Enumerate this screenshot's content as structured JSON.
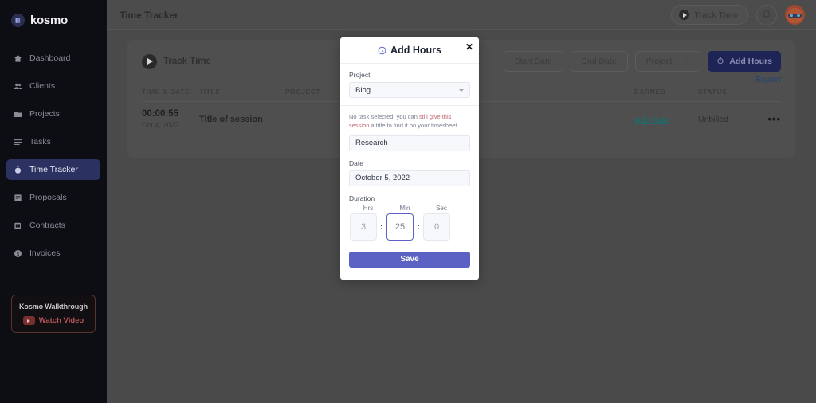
{
  "sidebar": {
    "brand": "kosmo",
    "brand_mark_icon": "kosmo-logo-icon",
    "items": [
      {
        "label": "Dashboard",
        "icon": "home-icon",
        "active": false
      },
      {
        "label": "Clients",
        "icon": "people-icon",
        "active": false
      },
      {
        "label": "Projects",
        "icon": "folder-icon",
        "active": false
      },
      {
        "label": "Tasks",
        "icon": "list-icon",
        "active": false
      },
      {
        "label": "Time Tracker",
        "icon": "stopwatch-icon",
        "active": true
      },
      {
        "label": "Proposals",
        "icon": "document-icon",
        "active": false
      },
      {
        "label": "Contracts",
        "icon": "contract-icon",
        "active": false
      },
      {
        "label": "Invoices",
        "icon": "dollar-circle-icon",
        "active": false
      }
    ],
    "walkthrough": {
      "title": "Kosmo Walkthrough",
      "link_label": "Watch Video",
      "icon": "youtube-icon"
    }
  },
  "topbar": {
    "page_title": "Time Tracker",
    "track_time_label": "Track Time",
    "track_time_icon": "play-circle-icon",
    "bell_icon": "bell-icon",
    "avatar_icon": "user-avatar"
  },
  "card": {
    "track_time_label": "Track Time",
    "filters": {
      "start_date": "Start Date",
      "end_date": "End Date",
      "project": "Project"
    },
    "add_hours_label": "Add Hours",
    "add_hours_icon": "stopwatch-icon",
    "export_label": "Export",
    "columns": [
      "TIME & DATE",
      "TITLE",
      "PROJECT",
      "EARNED",
      "STATUS"
    ],
    "rows": [
      {
        "duration": "00:00:55",
        "date": "Oct 4, 2022",
        "title": "Title of session",
        "project": "",
        "earned": "Add Rate",
        "status": "Unbilled",
        "more_icon": "ellipsis-icon"
      }
    ]
  },
  "modal": {
    "title": "Add Hours",
    "title_icon": "clock-icon",
    "close_icon": "close-icon",
    "project_label": "Project",
    "project_value": "Blog",
    "project_chevron_icon": "chevron-down-icon",
    "hint_prefix": "No task selected, you can ",
    "hint_highlight": "still give this session",
    "hint_suffix": " a title to find it on your timesheet.",
    "title_input_value": "Research",
    "date_label": "Date",
    "date_value": "October 5, 2022",
    "duration_label": "Duration",
    "duration_heads": [
      "Hrs",
      "Min",
      "Sec"
    ],
    "duration_values": [
      "3",
      "25",
      "0"
    ],
    "duration_separator": ":",
    "focused_field_index": 1,
    "save_label": "Save",
    "accent_color": "#5b62c4"
  }
}
